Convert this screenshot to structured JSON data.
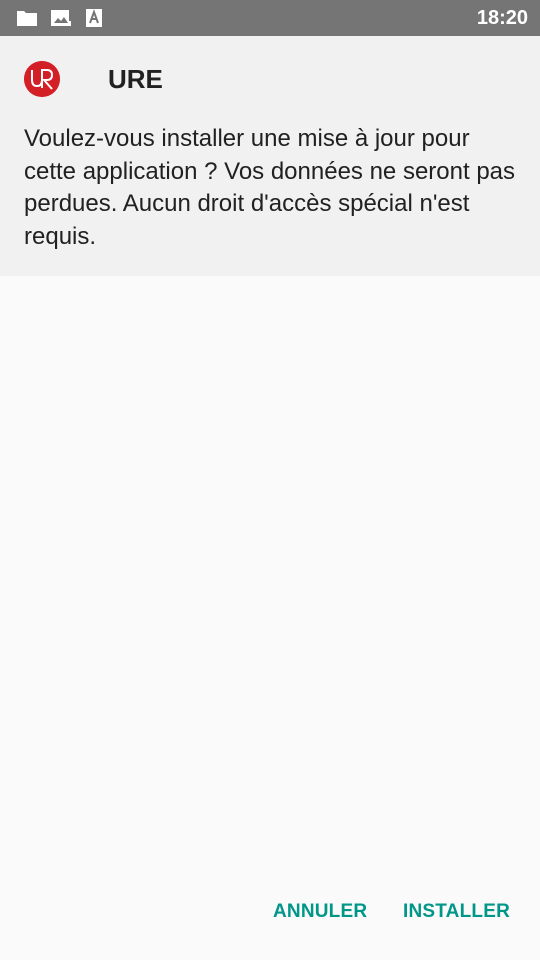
{
  "status_bar": {
    "time": "18:20",
    "icons": [
      "folder-icon",
      "image-notification-icon",
      "text-notification-icon"
    ]
  },
  "dialog": {
    "app_name": "URE",
    "app_logo_icon": "ure-logo-icon",
    "message": "Voulez-vous installer une mise à jour pour cette application ? Vos données ne seront pas perdues. Aucun droit d'accès spécial n'est requis."
  },
  "actions": {
    "cancel_label": "ANNULER",
    "install_label": "INSTALLER"
  },
  "colors": {
    "status_bar": "#757575",
    "header_background": "#f1f1f1",
    "body_background": "#fafafa",
    "accent": "#009688",
    "logo": "#d32027"
  }
}
